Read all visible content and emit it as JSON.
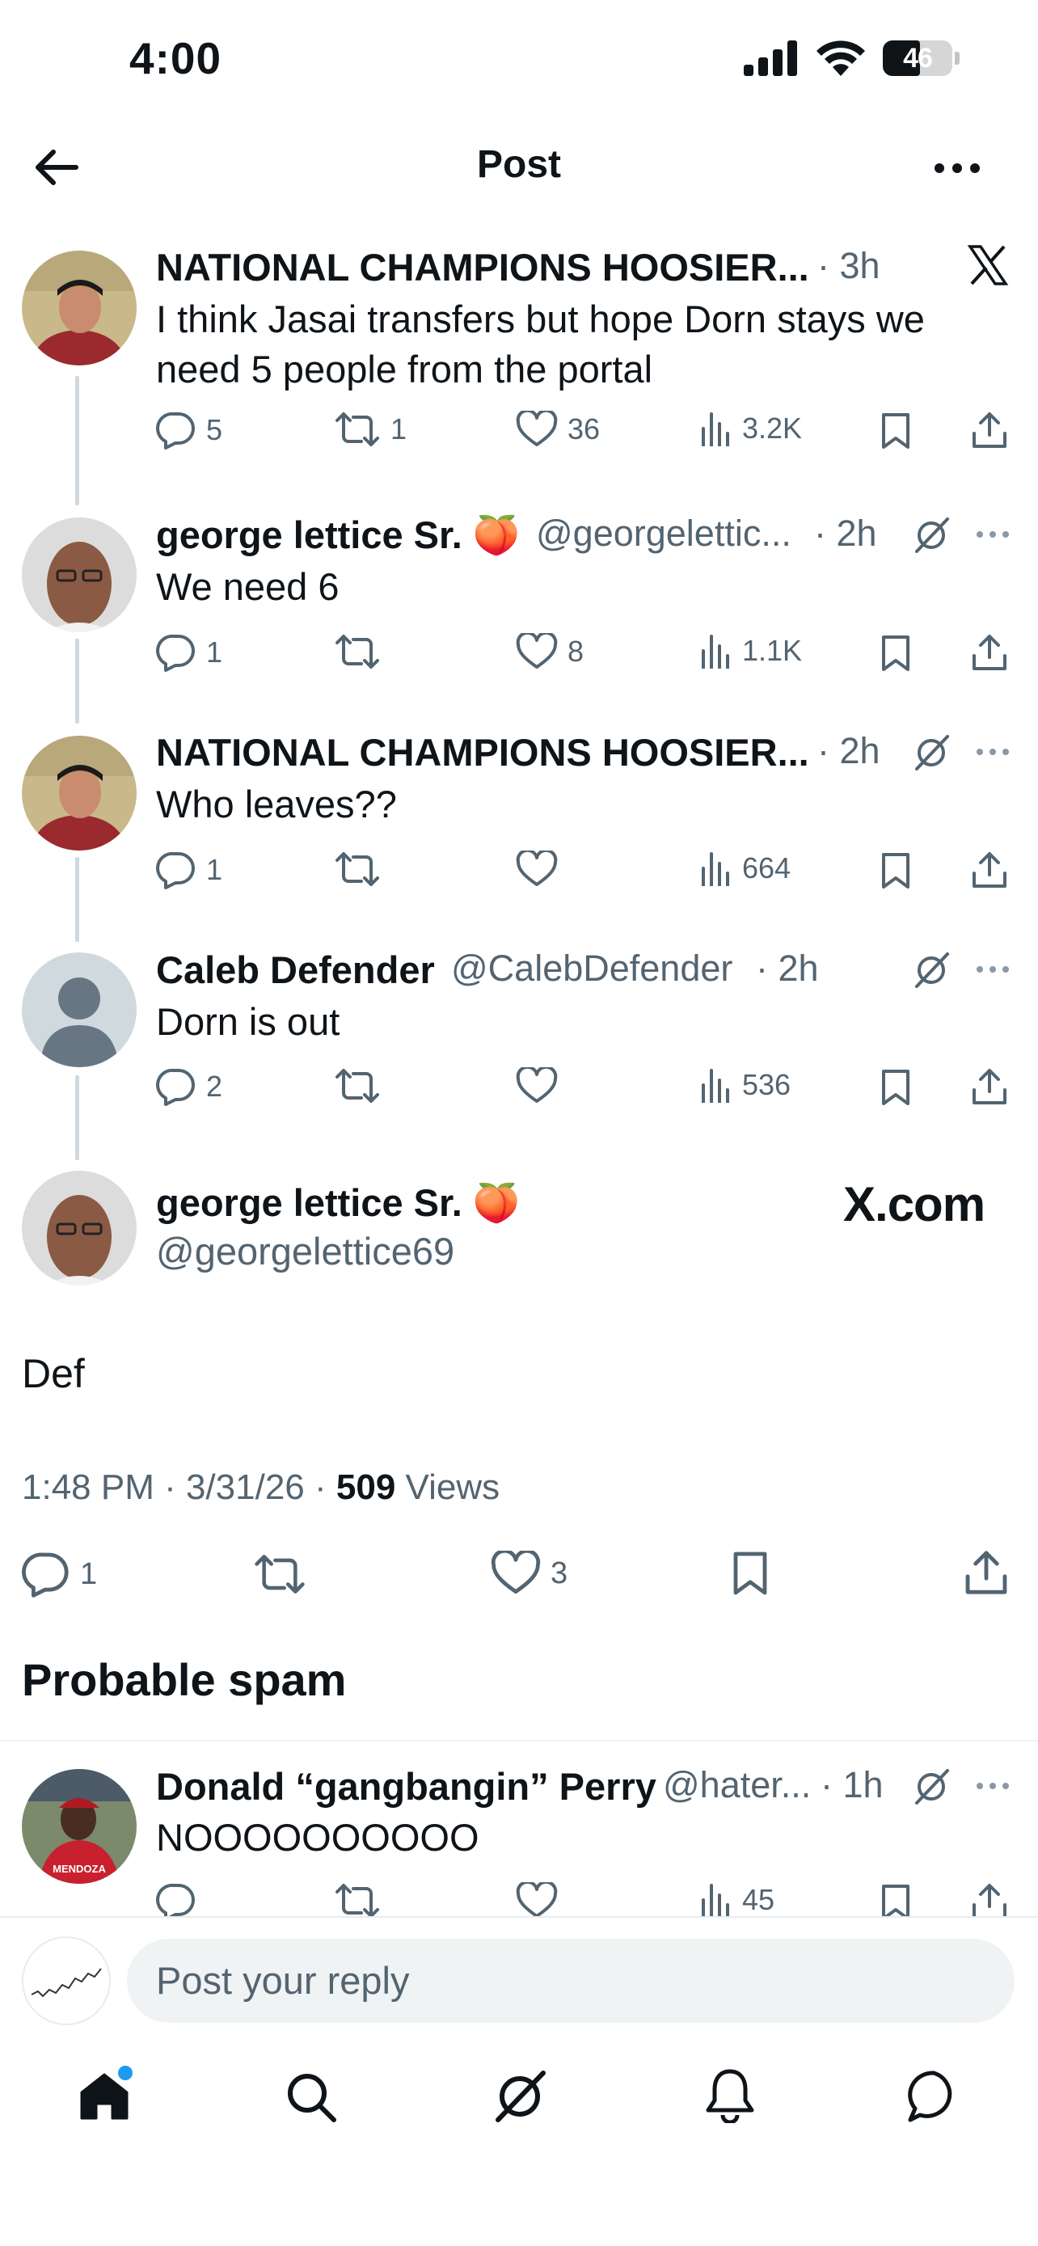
{
  "status_bar": {
    "time": "4:00",
    "battery": "46"
  },
  "header": {
    "title": "Post"
  },
  "thread": [
    {
      "name": "NATIONAL CHAMPIONS HOOSIER...",
      "handle": "",
      "time": "· 3h",
      "text_lines": [
        "I think Jasai transfers but hope Dorn stays we",
        "need 5 people from the portal"
      ],
      "replies": "5",
      "reposts": "1",
      "likes": "36",
      "views": "3.2K"
    },
    {
      "name": "george lettice Sr. 🍑",
      "handle": "@georgelettic...",
      "time": "· 2h",
      "text_lines": [
        "We need 6"
      ],
      "replies": "1",
      "reposts": "",
      "likes": "8",
      "views": "1.1K"
    },
    {
      "name": "NATIONAL CHAMPIONS HOOSIER...",
      "handle": "",
      "time": "· 2h",
      "text_lines": [
        "Who leaves??"
      ],
      "replies": "1",
      "reposts": "",
      "likes": "",
      "views": "664"
    },
    {
      "name": "Caleb Defender",
      "handle": "@CalebDefender",
      "time": "· 2h",
      "text_lines": [
        "Dorn is out"
      ],
      "replies": "2",
      "reposts": "",
      "likes": "",
      "views": "536"
    }
  ],
  "main_post": {
    "name": "george lettice Sr. 🍑",
    "handle": "@georgelettice69",
    "watermark": "X.com",
    "text": "Def",
    "timestamp": "1:48 PM · 3/31/26 · ",
    "views_count": "509",
    "views_label": " Views",
    "replies": "1",
    "likes": "3"
  },
  "spam_section": {
    "title": "Probable spam",
    "item": {
      "name": "Donald “gangbangin” Perry",
      "handle": "@hater...",
      "time": "· 1h",
      "text": "NOOOOOOOOOO",
      "views": "45"
    }
  },
  "reply_bar": {
    "placeholder": "Post your reply"
  },
  "nav": [
    "home-icon",
    "search-icon",
    "grok-icon",
    "notifications-icon",
    "messages-icon"
  ],
  "colors": {
    "accent": "#1d9bf0",
    "text": "#0f1419",
    "secondary": "#536471",
    "line": "#cfd9de"
  }
}
